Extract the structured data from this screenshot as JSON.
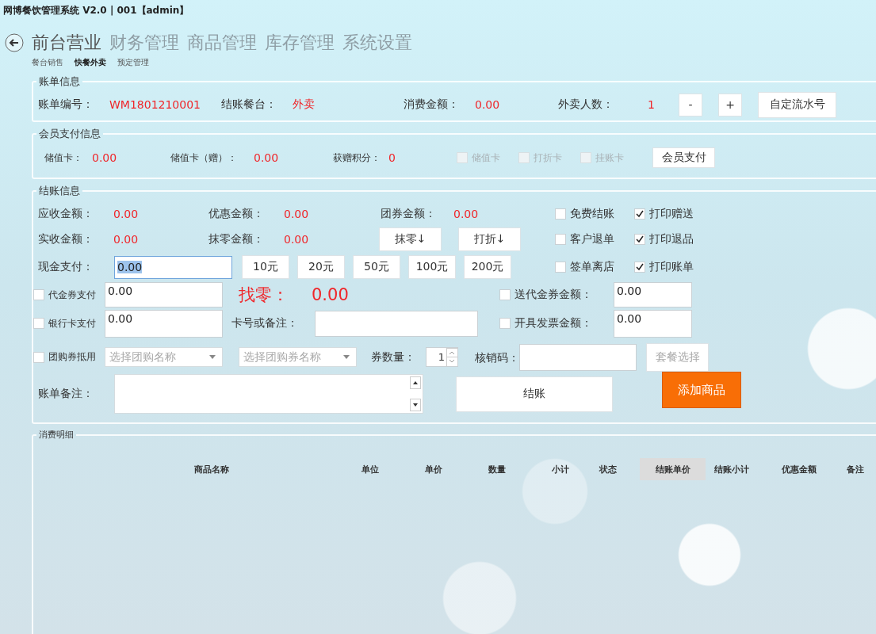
{
  "window": {
    "title": "网博餐饮管理系统 V2.0 | 001【admin】"
  },
  "main_tabs": [
    {
      "label": "前台营业",
      "selected": true
    },
    {
      "label": "财务管理",
      "selected": false
    },
    {
      "label": "商品管理",
      "selected": false
    },
    {
      "label": "库存管理",
      "selected": false
    },
    {
      "label": "系统设置",
      "selected": false
    }
  ],
  "sub_tabs": [
    {
      "label": "餐台销售",
      "selected": false
    },
    {
      "label": "快餐外卖",
      "selected": true
    },
    {
      "label": "预定管理",
      "selected": false
    }
  ],
  "bill_info": {
    "title": "账单信息",
    "fields": [
      {
        "label": "账单编号：",
        "value": "WM1801210001"
      },
      {
        "label": "结账餐台：",
        "value": "外卖"
      },
      {
        "label": "消费金额：",
        "value": "0.00"
      },
      {
        "label": "外卖人数：",
        "value": "1"
      }
    ],
    "minus_button": "-",
    "plus_button": "+",
    "serial_button": "自定流水号"
  },
  "member_payment": {
    "title": "会员支付信息",
    "fields": [
      {
        "label": "储值卡：",
        "value": "0.00"
      },
      {
        "label": "储值卡（赠）：",
        "value": "0.00"
      },
      {
        "label": "获赠积分：",
        "value": "0"
      }
    ],
    "options": [
      {
        "label": "储值卡",
        "checked": false,
        "disabled": true
      },
      {
        "label": "打折卡",
        "checked": false,
        "disabled": true
      },
      {
        "label": "挂账卡",
        "checked": false,
        "disabled": true
      }
    ],
    "pay_button": "会员支付"
  },
  "checkout": {
    "title": "结账信息",
    "amounts": [
      {
        "label": "应收金额：",
        "value": "0.00"
      },
      {
        "label": "优惠金额：",
        "value": "0.00"
      },
      {
        "label": "团券金额：",
        "value": "0.00"
      },
      {
        "label": "实收金额：",
        "value": "0.00"
      },
      {
        "label": "抹零金额：",
        "value": "0.00"
      }
    ],
    "round_button": "抹零↓",
    "discount_button": "打折↓",
    "options": [
      {
        "label": "免费结账",
        "checked": false
      },
      {
        "label": "打印赠送",
        "checked": true
      },
      {
        "label": "客户退单",
        "checked": false
      },
      {
        "label": "打印退品",
        "checked": true
      },
      {
        "label": "签单离店",
        "checked": false
      },
      {
        "label": "打印账单",
        "checked": true
      }
    ],
    "cash": {
      "label": "现金支付：",
      "value": "0.00"
    },
    "quick_amounts": [
      "10元",
      "20元",
      "50元",
      "100元",
      "200元"
    ],
    "voucher": {
      "label": "代金券支付",
      "checked": false,
      "value": "0.00"
    },
    "change": {
      "label": "找零：",
      "value": "0.00"
    },
    "gift_voucher": {
      "label": "送代金券金额：",
      "checked": false,
      "value": "0.00"
    },
    "bank_card": {
      "label": "银行卡支付",
      "checked": false,
      "value": "0.00"
    },
    "card_note": {
      "label": "卡号或备注："
    },
    "invoice": {
      "label": "开具发票金额：",
      "checked": false,
      "value": "0.00"
    },
    "group_buy": {
      "label": "团购券抵用",
      "checked": false,
      "deal_placeholder": "选择团购名称",
      "voucher_placeholder": "选择团购券名称"
    },
    "voucher_count": {
      "label": "券数量：",
      "value": "1"
    },
    "verify_code": {
      "label": "核销码："
    },
    "package_button": "套餐选择",
    "bill_note": {
      "label": "账单备注："
    },
    "checkout_button": "结账",
    "add_button": "添加商品"
  },
  "details": {
    "title": "消费明细",
    "columns": [
      {
        "label": "商品名称",
        "selected": false
      },
      {
        "label": "单位",
        "selected": false
      },
      {
        "label": "单价",
        "selected": false
      },
      {
        "label": "数量",
        "selected": false
      },
      {
        "label": "小计",
        "selected": false
      },
      {
        "label": "状态",
        "selected": false
      },
      {
        "label": "结账单价",
        "selected": true
      },
      {
        "label": "结账小计",
        "selected": false
      },
      {
        "label": "优惠金额",
        "selected": false
      },
      {
        "label": "备注",
        "selected": false
      }
    ]
  }
}
